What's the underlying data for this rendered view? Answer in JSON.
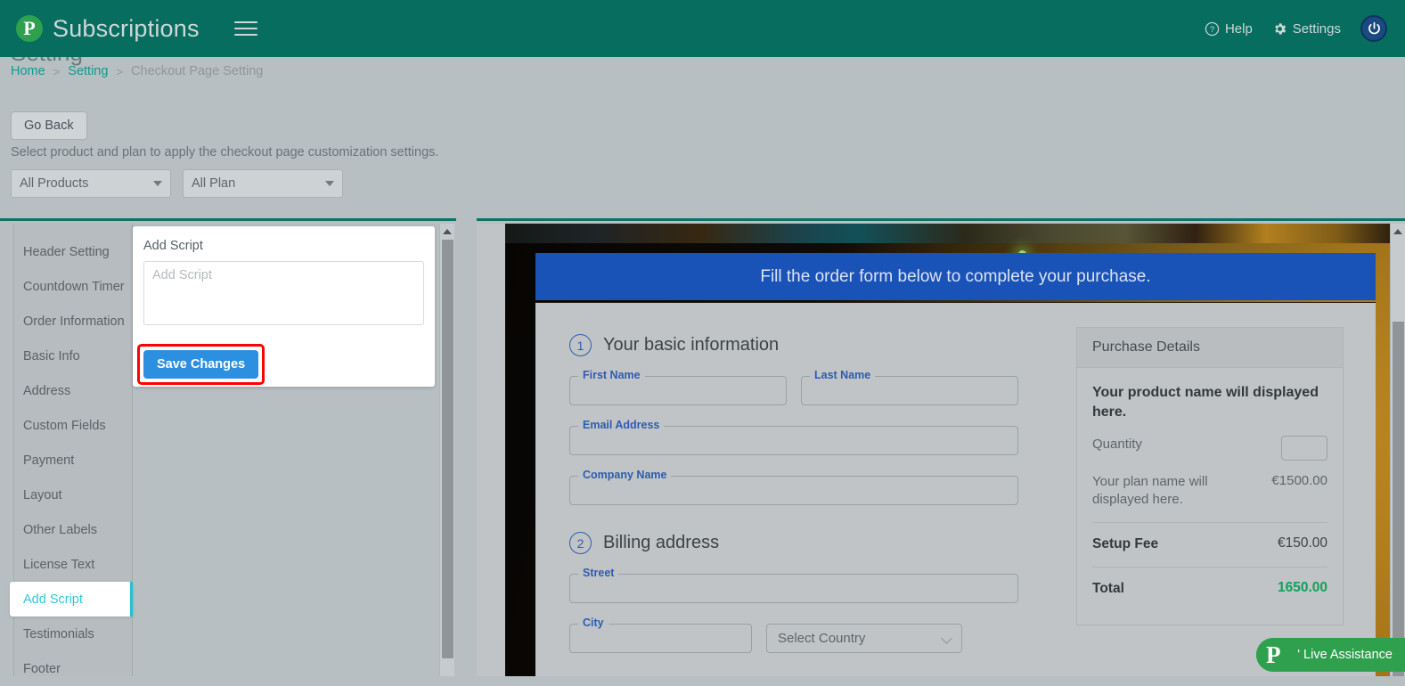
{
  "topbar": {
    "brand": "Subscriptions",
    "logo_letter": "P",
    "menu_icon": "hamburger-icon",
    "help_label": "Help",
    "settings_label": "Settings",
    "brand_color": "#066d5f",
    "logo_color": "#2fa04e"
  },
  "page": {
    "title": "Setting",
    "breadcrumb": {
      "home": "Home",
      "sep1": ">",
      "setting": "Setting",
      "sep2": ">",
      "current": "Checkout Page Setting"
    }
  },
  "toolbar": {
    "go_back_label": "Go Back",
    "helper_text": "Select product and plan to apply the checkout page customization settings.",
    "product_select": "All Products",
    "plan_select": "All Plan"
  },
  "sidebar": {
    "items": [
      {
        "label": "Header Setting",
        "active": false
      },
      {
        "label": "Countdown Timer",
        "active": false
      },
      {
        "label": "Order Information",
        "active": false
      },
      {
        "label": "Basic Info",
        "active": false
      },
      {
        "label": "Address",
        "active": false
      },
      {
        "label": "Custom Fields",
        "active": false
      },
      {
        "label": "Payment",
        "active": false
      },
      {
        "label": "Layout",
        "active": false
      },
      {
        "label": "Other Labels",
        "active": false
      },
      {
        "label": "License Text",
        "active": false
      },
      {
        "label": "Add Script",
        "active": true
      },
      {
        "label": "Testimonials",
        "active": false
      },
      {
        "label": "Footer",
        "active": false
      }
    ],
    "active_color": "#22c1d3"
  },
  "script_panel": {
    "heading": "Add Script",
    "textarea_placeholder": "Add Script",
    "textarea_value": "",
    "save_label": "Save Changes",
    "save_color": "#2d8fe0",
    "highlight_color": "#ff0000"
  },
  "preview": {
    "banner_text": "Fill the order form below to complete your purchase.",
    "banner_color": "#1a53b8",
    "step1": {
      "number": "1",
      "title": "Your basic information",
      "fields": [
        {
          "label": "First Name",
          "value": ""
        },
        {
          "label": "Last Name",
          "value": ""
        },
        {
          "label": "Email Address",
          "value": ""
        },
        {
          "label": "Company Name",
          "value": ""
        }
      ]
    },
    "step2": {
      "number": "2",
      "title": "Billing address",
      "street_label": "Street",
      "city_label": "City",
      "country_placeholder": "Select Country"
    },
    "purchase": {
      "heading": "Purchase Details",
      "product_name": "Your product name will displayed here.",
      "quantity_label": "Quantity",
      "quantity_value": "",
      "plan_name": "Your plan name will displayed here.",
      "plan_price": "€1500.00",
      "setup_fee_label": "Setup Fee",
      "setup_fee_value": "€150.00",
      "total_label": "Total",
      "total_value": "1650.00",
      "total_color": "#12a05a"
    }
  },
  "live_assistance": {
    "label": "' Live Assistance",
    "logo_letter": "P",
    "color": "#2fa04e"
  }
}
